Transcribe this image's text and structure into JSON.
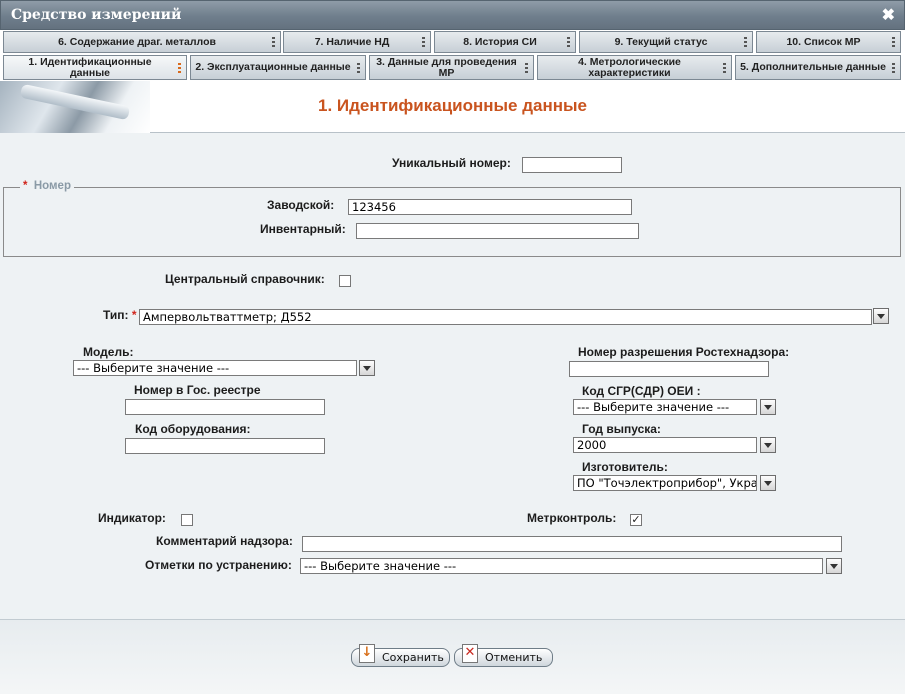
{
  "window": {
    "title": "Средство измерений"
  },
  "tabs_top": [
    {
      "label": "6. Содержание драг. металлов"
    },
    {
      "label": "7. Наличие НД"
    },
    {
      "label": "8. История СИ"
    },
    {
      "label": "9. Текущий статус"
    },
    {
      "label": "10. Список МР"
    }
  ],
  "tabs_bottom": [
    {
      "label": "1. Идентификационные данные",
      "active": true
    },
    {
      "label": "2. Эксплуатационные данные"
    },
    {
      "label": "3. Данные для проведения МР"
    },
    {
      "label": "4. Метрологические характеристики"
    },
    {
      "label": "5. Дополнительные данные"
    }
  ],
  "page": {
    "heading": "1. Идентификационные данные"
  },
  "form": {
    "unique_number": {
      "label": "Уникальный номер:",
      "value": ""
    },
    "nomer": {
      "legend": "Номер",
      "required_mark": "*"
    },
    "factory": {
      "label": "Заводской:",
      "value": "123456"
    },
    "inventory": {
      "label": "Инвентарный:",
      "value": ""
    },
    "central_ref": {
      "label": "Центральный справочник:",
      "checked": false
    },
    "type": {
      "label": "Тип:",
      "required_mark": "*",
      "value": "Ампервольтваттметр; Д552"
    },
    "model": {
      "label": "Модель:",
      "value": "--- Выберите значение ---"
    },
    "gos_reestr": {
      "label": "Номер в Гос. реестре",
      "value": ""
    },
    "equipment_code": {
      "label": "Код оборудования:",
      "value": ""
    },
    "rtn_permit": {
      "label": "Номер разрешения Ростехнадзора:",
      "value": ""
    },
    "sgr_code": {
      "label": "Код СГР(СДР) ОЕИ :",
      "value": "--- Выберите значение ---"
    },
    "year": {
      "label": "Год выпуска:",
      "value": "2000"
    },
    "manufacturer": {
      "label": "Изготовитель:",
      "value": "ПО \"Точэлектроприбор\", Украи"
    },
    "indicator": {
      "label": "Индикатор:",
      "checked": false
    },
    "metrocontrol": {
      "label": "Метрконтроль:",
      "checked": true
    },
    "supervision_comment": {
      "label": "Комментарий надзора:",
      "value": ""
    },
    "fix_marks": {
      "label": "Отметки по устранению:",
      "value": "--- Выберите значение ---"
    }
  },
  "buttons": {
    "save": "Сохранить",
    "cancel": "Отменить"
  },
  "icons": {
    "close": "close-icon",
    "save": "save-icon",
    "cancel": "cancel-icon"
  },
  "colors": {
    "heading": "#c9541f",
    "required": "#d0241b",
    "titlebar": "#6f7e8c"
  }
}
